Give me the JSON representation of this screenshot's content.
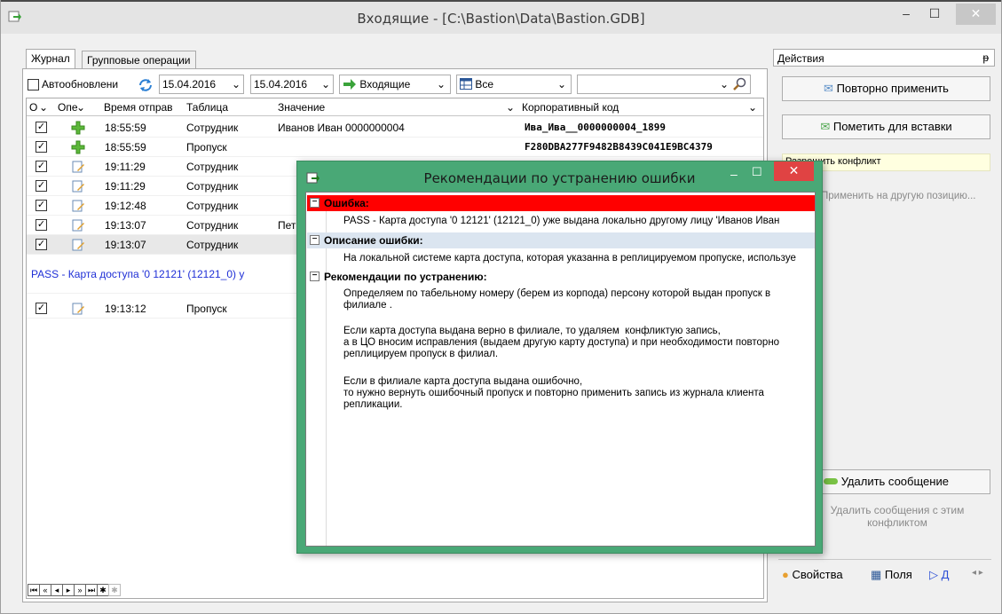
{
  "window": {
    "title": "Входящие - [C:\\Bastion\\Data\\Bastion.GDB]",
    "minimize": "–",
    "maximize": "☐",
    "close": "✕"
  },
  "tabs": [
    "Журнал",
    "Групповые операции"
  ],
  "toolbar": {
    "autoupdate": "Автообновлени",
    "date_from": "15.04.2016",
    "date_to": "15.04.2016",
    "direction": "Входящие",
    "filter": "Все"
  },
  "grid": {
    "headers": [
      "О",
      "Опе",
      "Время отправ",
      "Таблица",
      "Значение",
      "Корпоративный код"
    ],
    "rows": [
      {
        "time": "18:55:59",
        "table": "Сотрудник",
        "value": "Иванов Иван  0000000004",
        "code": "Ива_Ива__0000000004_1899"
      },
      {
        "time": "18:55:59",
        "table": "Пропуск",
        "value": "",
        "code": "F280DBA277F9482B8439C041E9BC4379"
      },
      {
        "time": "19:11:29",
        "table": "Сотрудник",
        "value": "",
        "code": ""
      },
      {
        "time": "19:11:29",
        "table": "Сотрудник",
        "value": "",
        "code": ""
      },
      {
        "time": "19:12:48",
        "table": "Сотрудник",
        "value": "",
        "code": ""
      },
      {
        "time": "19:13:07",
        "table": "Сотрудник",
        "value": "Пет",
        "code": ""
      },
      {
        "time": "19:13:07",
        "table": "Сотрудник",
        "value": "",
        "code": ""
      }
    ],
    "error_text": "PASS - Карта доступа '0 12121' (12121_0) у",
    "last_row": {
      "time": "19:13:12",
      "table": "Пропуск"
    }
  },
  "right": {
    "header": "Действия",
    "pin": "ᵽ",
    "btn_reapply": "Повторно применить",
    "btn_mark": "Пометить для вставки",
    "resolve": "Разрешить конфликт",
    "apply_other": "Применить на другую позицию...",
    "btn_delete": "Удалить сообщение",
    "delete_all": "Удалить сообщения с этим конфликтом",
    "tab_props": "Свойства",
    "tab_fields": "Поля",
    "tab_d": "Д"
  },
  "dialog": {
    "title": "Рекомендации по устранению ошибки",
    "error_header": "Ошибка:",
    "error_text": "PASS - Карта доступа '0 12121' (12121_0) уже выдана локально другому лицу 'Иванов Иван",
    "desc_header": "Описание ошибки:",
    "desc_text": "На локальной системе карта доступа, которая указанна в реплицируемом пропуске, используе",
    "rec_header": "Рекомендации по устранению:",
    "rec_p1": "Определяем по табельному номеру (берем из корпода) персону которой выдан пропуск в филиале .",
    "rec_p2": "Если карта доступа выдана верно в филиале, то удаляем  конфликтую запись,\nа в ЦО вносим исправления (выдаем другую карту доступа) и при необходимости повторно реплицируем пропуск в филиал.",
    "rec_p3": "Если в филиале карта доступа выдана ошибочно,\nто нужно вернуть ошибочный пропуск и повторно применить запись из журнала клиента репликации."
  }
}
